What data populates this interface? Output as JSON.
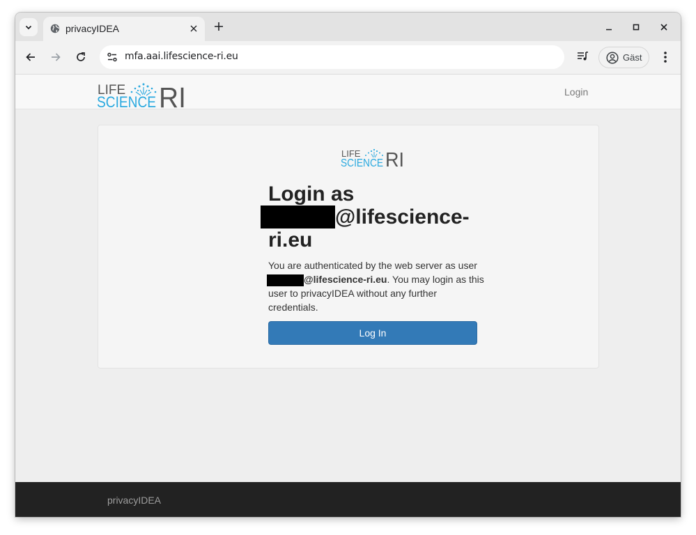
{
  "browser": {
    "tab_title": "privacyIDEA",
    "url": "mfa.aai.lifescience-ri.eu",
    "profile_label": "Gäst"
  },
  "navbar": {
    "brand_logo": {
      "line1": "LIFE",
      "line2": "SCIENCE",
      "mark": "RI"
    },
    "login_link": "Login"
  },
  "panel": {
    "logo": {
      "line1": "LIFE",
      "line2": "SCIENCE",
      "mark": "RI"
    },
    "title_prefix": "Login as",
    "title_user_suffix": "@lifescience-ri.eu",
    "message_part1": "You are authenticated by the web server as user",
    "message_user_suffix": "@lifescience-ri.eu",
    "message_part2": ". You may login as this user to privacyIDEA without any further credentials.",
    "login_button": "Log In"
  },
  "footer": {
    "text": "privacyIDEA"
  },
  "colors": {
    "primary_button": "#337ab7",
    "logo_blue": "#2aa9df",
    "logo_gray": "#555555",
    "footer_bg": "#222222"
  }
}
